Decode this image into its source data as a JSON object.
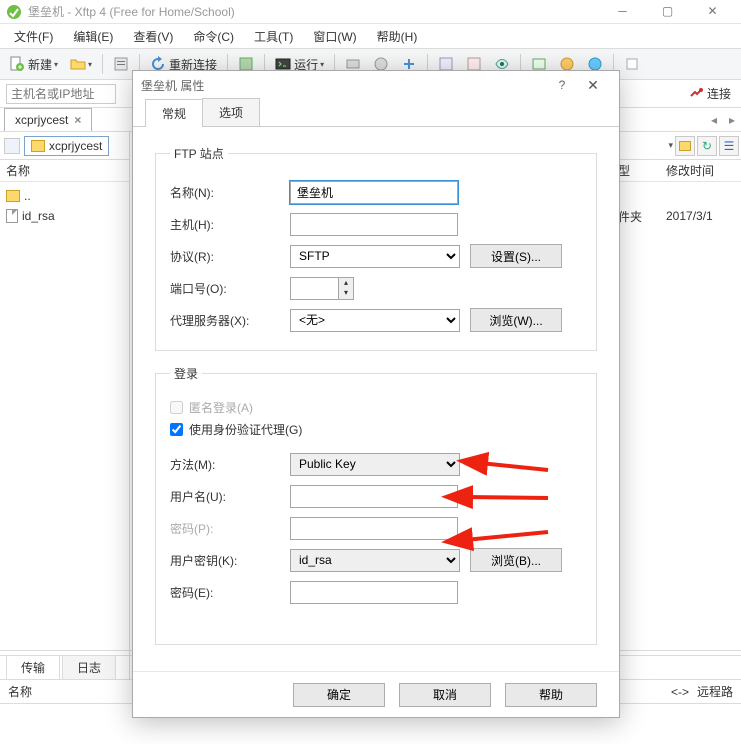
{
  "titlebar": {
    "title": "堡垒机 - Xftp 4 (Free for Home/School)"
  },
  "menu": {
    "file": "文件(F)",
    "edit": "编辑(E)",
    "view": "查看(V)",
    "command": "命令(C)",
    "tools": "工具(T)",
    "window": "窗口(W)",
    "help": "帮助(H)"
  },
  "toolbar": {
    "new": "新建",
    "reconnect": "重新连接",
    "run": "运行"
  },
  "address": {
    "placeholder": "主机名或IP地址",
    "connect": "连接"
  },
  "tabs": {
    "doc": "xcprjycest"
  },
  "breadcrumb": {
    "current": "xcprjycest"
  },
  "list": {
    "col_name": "名称",
    "col_type": "型",
    "col_mtime": "修改时间",
    "items": [
      {
        "name": "..",
        "kind": "up"
      },
      {
        "name": "id_rsa",
        "kind": "file"
      }
    ],
    "right_items": [
      {
        "type": "件夹",
        "mtime": "2017/3/1"
      }
    ]
  },
  "bottom": {
    "tab_transfer": "传输",
    "tab_log": "日志",
    "col_name": "名称",
    "nav": "<->",
    "remote": "远程路"
  },
  "dialog": {
    "title": "堡垒机 属性",
    "tab_general": "常规",
    "tab_options": "选项",
    "ftp_group": "FTP 站点",
    "lbl_name": "名称(N):",
    "val_name": "堡垒机",
    "lbl_host": "主机(H):",
    "val_host": "",
    "lbl_proto": "协议(R):",
    "val_proto": "SFTP",
    "btn_settings": "设置(S)...",
    "lbl_port": "端口号(O):",
    "val_port": "",
    "lbl_proxy": "代理服务器(X):",
    "val_proxy": "<无>",
    "btn_browseW": "浏览(W)...",
    "login_group": "登录",
    "chk_anon": "匿名登录(A)",
    "chk_agent": "使用身份验证代理(G)",
    "lbl_method": "方法(M):",
    "val_method": "Public Key",
    "lbl_user": "用户名(U):",
    "val_user": "",
    "lbl_pass": "密码(P):",
    "lbl_key": "用户密钥(K):",
    "val_key": "id_rsa",
    "btn_browseB": "浏览(B)...",
    "lbl_keypass": "密码(E):",
    "btn_ok": "确定",
    "btn_cancel": "取消",
    "btn_help": "帮助"
  }
}
